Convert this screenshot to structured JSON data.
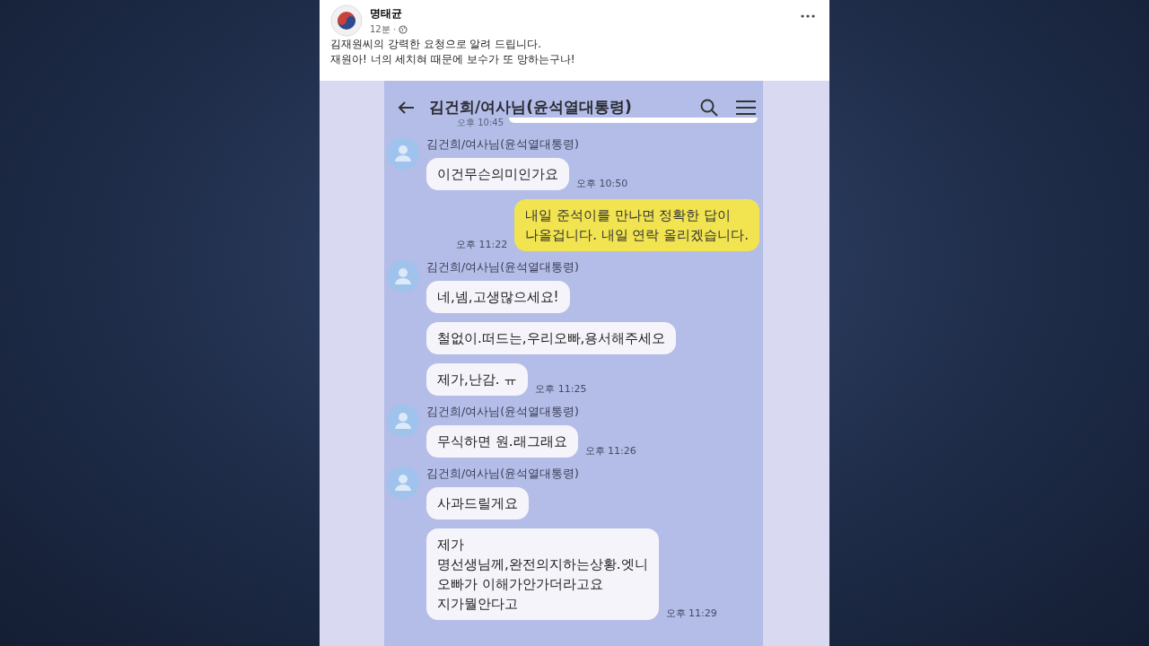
{
  "post": {
    "author": "명태균",
    "time": "12분 ·",
    "lines": [
      "김재원씨의 강력한 요청으로 알려 드립니다.",
      "재원아! 너의 세치혀 때문에 보수가 또 망하는구나!"
    ]
  },
  "chat": {
    "title": "김건희/여사님(윤석열대통령)",
    "groups": [
      {
        "kind": "cut",
        "time": "오후 10:45"
      },
      {
        "kind": "incoming",
        "sender": "김건희/여사님(윤석열대통령)",
        "messages": [
          "이건무슨의미인가요"
        ],
        "time": "오후 10:50"
      },
      {
        "kind": "outgoing",
        "messages": [
          "내일 준석이를 만나면 정확한 답이\n나올겁니다. 내일 연락 올리겠습니다."
        ],
        "time": "오후 11:22"
      },
      {
        "kind": "incoming",
        "sender": "김건희/여사님(윤석열대통령)",
        "messages": [
          "네,넴,고생많으세요!",
          "철없이.떠드는,우리오빠,용서해주세오",
          "제가,난감. ㅠ"
        ],
        "time": "오후 11:25"
      },
      {
        "kind": "incoming",
        "sender": "김건희/여사님(윤석열대통령)",
        "messages": [
          "무식하면 원.래그래요"
        ],
        "time": "오후 11:26"
      },
      {
        "kind": "incoming",
        "sender": "김건희/여사님(윤석열대통령)",
        "messages": [
          "사과드릴게요",
          "제가\n명선생님께,완전의지하는상황.엣니\n오빠가 이해가안가더라고요\n지가뭘안다고"
        ],
        "time": "오후 11:29"
      }
    ]
  }
}
